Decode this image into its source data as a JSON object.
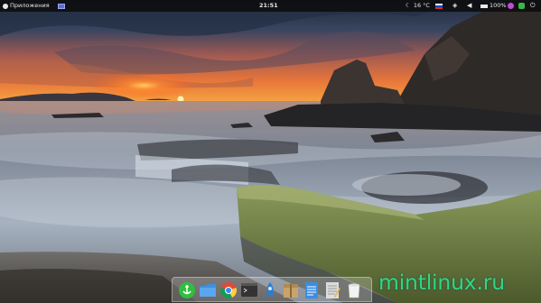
{
  "top_panel": {
    "applications_label": "Приложения",
    "clock": "21:51",
    "weather_temp": "16 °C",
    "battery_percent": "100%",
    "colors": {
      "background": "#0c0c0e",
      "text": "#e8e8e8"
    }
  },
  "dock": {
    "items": [
      {
        "name": "anchor-app-icon",
        "color": "#2fbf3f"
      },
      {
        "name": "files-folder-icon",
        "color": "#3e8fe0"
      },
      {
        "name": "chrome-browser-icon",
        "color": "#dd4b39"
      },
      {
        "name": "terminal-icon",
        "color": "#333333"
      },
      {
        "name": "rocket-app-icon",
        "color": "#2a7fd0"
      },
      {
        "name": "archive-manager-icon",
        "color": "#c9a36a"
      },
      {
        "name": "document-viewer-icon",
        "color": "#3a8ee6"
      },
      {
        "name": "text-editor-icon",
        "color": "#dcdcdc"
      },
      {
        "name": "trash-icon",
        "color": "#f2f2f2"
      }
    ]
  },
  "watermark": {
    "text": "mintlinux.ru",
    "color": "#2fd58a"
  }
}
